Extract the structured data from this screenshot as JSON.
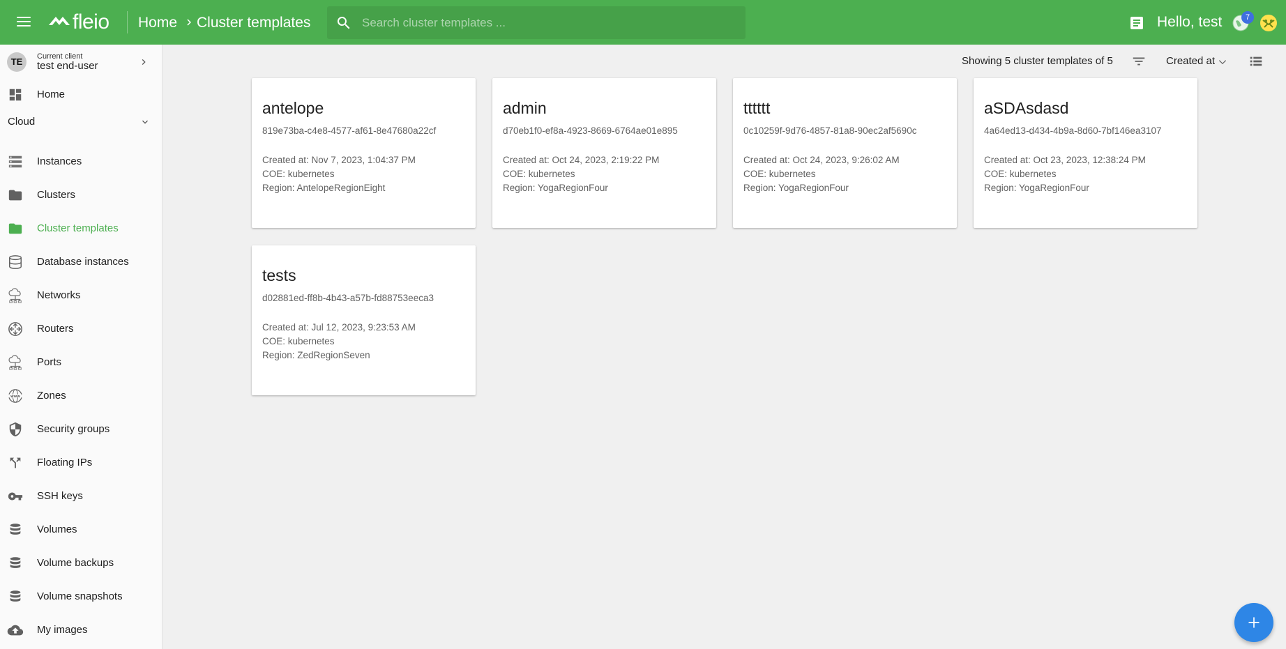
{
  "brand": {
    "name": "fleio"
  },
  "breadcrumb": {
    "home": "Home",
    "current": "Cluster templates"
  },
  "search": {
    "placeholder": "Search cluster templates ..."
  },
  "user": {
    "greeting": "Hello, test",
    "notification_count": "7"
  },
  "client": {
    "initials": "TE",
    "label": "Current client",
    "name": "test end-user"
  },
  "sidebar": {
    "home": "Home",
    "section": "Cloud",
    "items": [
      {
        "label": "Instances",
        "icon": "server-list-icon"
      },
      {
        "label": "Clusters",
        "icon": "folder-icon"
      },
      {
        "label": "Cluster templates",
        "icon": "folder-icon",
        "active": true
      },
      {
        "label": "Database instances",
        "icon": "database-icon"
      },
      {
        "label": "Networks",
        "icon": "cloud-network-icon"
      },
      {
        "label": "Routers",
        "icon": "router-icon"
      },
      {
        "label": "Ports",
        "icon": "cloud-network-icon"
      },
      {
        "label": "Zones",
        "icon": "www-globe-icon"
      },
      {
        "label": "Security groups",
        "icon": "shield-icon"
      },
      {
        "label": "Floating IPs",
        "icon": "call-split-icon"
      },
      {
        "label": "SSH keys",
        "icon": "key-icon"
      },
      {
        "label": "Volumes",
        "icon": "storage-stack-icon"
      },
      {
        "label": "Volume backups",
        "icon": "storage-stack-icon"
      },
      {
        "label": "Volume snapshots",
        "icon": "storage-stack-icon"
      },
      {
        "label": "My images",
        "icon": "cloud-upload-icon"
      }
    ]
  },
  "toolbar": {
    "count_text": "Showing 5 cluster templates of 5",
    "sort_label": "Created at"
  },
  "templates": [
    {
      "name": "antelope",
      "id": "819e73ba-c4e8-4577-af61-8e47680a22cf",
      "created": "Created at: Nov 7, 2023, 1:04:37 PM",
      "coe": "COE: kubernetes",
      "region": "Region: AntelopeRegionEight"
    },
    {
      "name": "admin",
      "id": "d70eb1f0-ef8a-4923-8669-6764ae01e895",
      "created": "Created at: Oct 24, 2023, 2:19:22 PM",
      "coe": "COE: kubernetes",
      "region": "Region: YogaRegionFour"
    },
    {
      "name": "tttttt",
      "id": "0c10259f-9d76-4857-81a8-90ec2af5690c",
      "created": "Created at: Oct 24, 2023, 9:26:02 AM",
      "coe": "COE: kubernetes",
      "region": "Region: YogaRegionFour"
    },
    {
      "name": "aSDAsdasd",
      "id": "4a64ed13-d434-4b9a-8d60-7bf146ea3107",
      "created": "Created at: Oct 23, 2023, 12:38:24 PM",
      "coe": "COE: kubernetes",
      "region": "Region: YogaRegionFour"
    },
    {
      "name": "tests",
      "id": "d02881ed-ff8b-4b43-a57b-fd88753eeca3",
      "created": "Created at: Jul 12, 2023, 9:23:53 AM",
      "coe": "COE: kubernetes",
      "region": "Region: ZedRegionSeven"
    }
  ],
  "colors": {
    "topbar": "#4caf50",
    "active": "#4caf50",
    "fab": "#2e86e6"
  }
}
